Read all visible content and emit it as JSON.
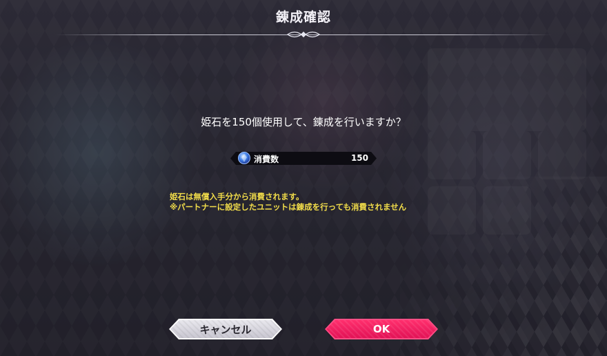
{
  "dialog": {
    "title": "錬成確認",
    "message": "姫石を150個使用して、錬成を行いますか？",
    "cost": {
      "label": "消費数",
      "value": "150",
      "icon": "gem-icon"
    },
    "notes": [
      "姫石は無償入手分から消費されます。",
      "※パートナーに設定したユニットは錬成を行っても消費されません"
    ],
    "buttons": {
      "cancel": "キャンセル",
      "ok": "OK"
    }
  },
  "colors": {
    "accent": "#ff2f6d",
    "note": "#f2dd4a",
    "cancel_button": "#d9d8e0"
  }
}
